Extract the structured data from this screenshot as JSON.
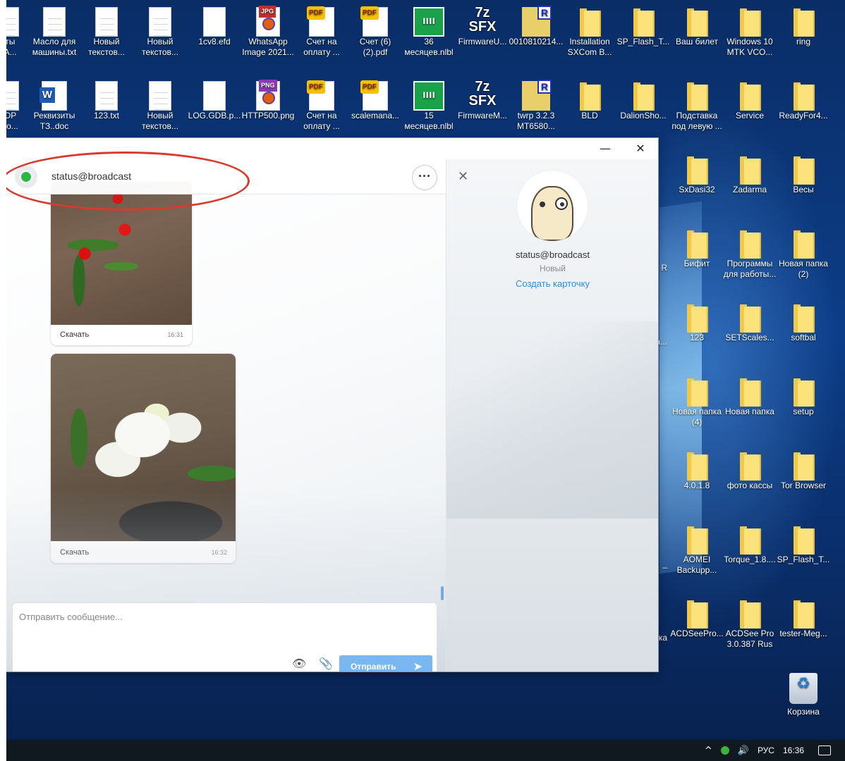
{
  "desktop": {
    "row1": [
      {
        "label": "иты\nPA...",
        "icon": "document-icon"
      },
      {
        "label": "Масло для\nмашины.txt",
        "icon": "text-file-icon"
      },
      {
        "label": "Новый\nтекстов...",
        "icon": "text-file-icon"
      },
      {
        "label": "Новый\nтекстов...",
        "icon": "text-file-icon"
      },
      {
        "label": "1cv8.efd",
        "icon": "file-icon"
      },
      {
        "label": "WhatsApp\nImage 2021...",
        "icon": "jpg-image-icon",
        "badge": "JPG"
      },
      {
        "label": "Счет на\nоплату ...",
        "icon": "pdf-icon",
        "badge": "PDF"
      },
      {
        "label": "Счет (6)\n(2).pdf",
        "icon": "pdf-icon",
        "badge": "PDF"
      },
      {
        "label": "36\nмесяцев.nlbl",
        "icon": "label-file-icon"
      },
      {
        "label": "FirmwareU...",
        "icon": "7z-sfx-icon",
        "badge": "7z\nSFX"
      },
      {
        "label": "0010810214...",
        "icon": "rar-icon",
        "badge": "R"
      },
      {
        "label": "Installation\nSXCom B...",
        "icon": "folder-icon"
      },
      {
        "label": "SP_Flash_T...",
        "icon": "folder-icon"
      },
      {
        "label": "Ваш билет",
        "icon": "folder-icon"
      },
      {
        "label": "Windows 10\nMTK VCO...",
        "icon": "folder-icon"
      },
      {
        "label": "ring",
        "icon": "folder-icon"
      }
    ],
    "row2": [
      {
        "label": "ЗОР\nово...",
        "icon": "document-icon"
      },
      {
        "label": "Реквизиты\nТЗ..doc",
        "icon": "word-doc-icon",
        "badge": "W"
      },
      {
        "label": "123.txt",
        "icon": "text-file-icon"
      },
      {
        "label": "Новый\nтекстов...",
        "icon": "text-file-icon"
      },
      {
        "label": "LOG.GDB.p...",
        "icon": "file-icon"
      },
      {
        "label": "HTTP500.png",
        "icon": "png-image-icon",
        "badge": "PNG"
      },
      {
        "label": "Счет на\nоплату ...",
        "icon": "pdf-icon",
        "badge": "PDF"
      },
      {
        "label": "scalemana...",
        "icon": "pdf-icon",
        "badge": "PDF"
      },
      {
        "label": "15\nмесяцев.nlbl",
        "icon": "label-file-icon"
      },
      {
        "label": "FirmwareM...",
        "icon": "7z-sfx-icon",
        "badge": "7z\nSFX"
      },
      {
        "label": "twrp 3.2.3\nMT6580...",
        "icon": "rar-icon",
        "badge": "R"
      },
      {
        "label": "BLD",
        "icon": "folder-icon"
      },
      {
        "label": "DalionSho...",
        "icon": "folder-icon"
      },
      {
        "label": "Подставка\nпод левую ...",
        "icon": "folder-icon"
      },
      {
        "label": "Service",
        "icon": "folder-icon"
      },
      {
        "label": "ReadyFor4...",
        "icon": "folder-icon"
      }
    ],
    "right_cols": [
      [
        "SxDasi32",
        "Zadarma",
        "Весы"
      ],
      [
        "Бифит",
        "Программы\nдля работы...",
        "Новая папка\n(2)"
      ],
      [
        "123",
        "SETScales...",
        "softbal"
      ],
      [
        "Новая папка\n(4)",
        "Новая папка",
        "setup"
      ],
      [
        "4.0.1.8",
        "фото кассы",
        "Tor Browser"
      ],
      [
        "AOMEI\nBackupp...",
        "Torque_1.8....",
        "SP_Flash_T..."
      ],
      [
        "ACDSeePro...",
        "ACDSee Pro\n3.0.387 Rus",
        "tester-Meg..."
      ]
    ],
    "edge_labels": [
      "R",
      "а...",
      "_",
      "ка"
    ],
    "recycle_bin": "Корзина"
  },
  "taskbar": {
    "tray_chevron": "^",
    "volume_icon": "🔊",
    "language": "РУС",
    "time": "16:36"
  },
  "window": {
    "minimize": "—",
    "close": "✕"
  },
  "chat": {
    "contact": "status@broadcast",
    "more": "···",
    "messages": [
      {
        "download": "Скачать",
        "time": "16:31"
      },
      {
        "download": "Скачать",
        "time": "16:32"
      }
    ],
    "composer": {
      "placeholder": "Отправить сообщение...",
      "hide_icon": "👁",
      "attach_icon": "📎",
      "send_label": "Отправить",
      "send_arrow": "➤"
    }
  },
  "info": {
    "close": "✕",
    "name": "status@broadcast",
    "status": "Новый",
    "create_card": "Создать карточку"
  },
  "colors": {
    "accent": "#2f8de4",
    "send_button": "#7ab6f0",
    "annotation_oval": "#d93a2e",
    "folder": "#fbe27a"
  }
}
